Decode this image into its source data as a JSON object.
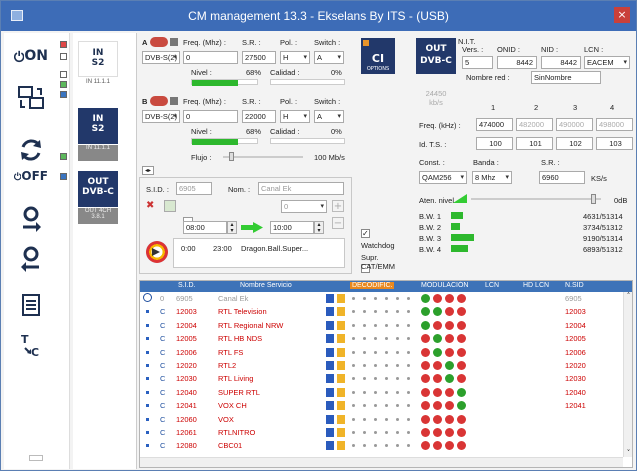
{
  "window": {
    "title": "CM management 13.3 - Ekselans By ITS - (USB)"
  },
  "colors": {
    "titlebar": "#3d6cb7",
    "accent": "#2a4f8f",
    "signal": "#2db82d",
    "crypt_red": "#cc2222"
  },
  "sidebar": {
    "on_label": "ON",
    "off_label": "OFF"
  },
  "tuners": [
    {
      "line1": "IN",
      "line2": "S2",
      "sub": "IN 11.1.1"
    },
    {
      "line1": "IN",
      "line2": "S2",
      "sub": "IN 11.1.1"
    },
    {
      "line1": "OUT",
      "line2": "DVB-C",
      "sub": "OUT 4CH 3.8.1"
    }
  ],
  "tuner_a": {
    "name": "A",
    "freq_label": "Freq. (Mhz) :",
    "sr_label": "S.R. :",
    "pol_label": "Pol. :",
    "switch_label": "Switch :",
    "mode": "DVB-S(2)",
    "freq": "0",
    "sr": "27500",
    "pol": "H",
    "switch": "A",
    "nivel_label": "Nivel :",
    "nivel": "68%",
    "calidad_label": "Calidad :",
    "calidad": "0%",
    "nivel_fraction": 0.68
  },
  "tuner_b": {
    "name": "B",
    "freq_label": "Freq. (Mhz) :",
    "sr_label": "S.R. :",
    "pol_label": "Pol. :",
    "switch_label": "Switch :",
    "mode": "DVB-S(2)",
    "freq": "0",
    "sr": "22000",
    "pol": "H",
    "switch": "A",
    "nivel_label": "Nivel :",
    "nivel": "68%",
    "calidad_label": "Calidad :",
    "calidad": "0%",
    "nivel_fraction": 0.68
  },
  "flujo": {
    "label": "Flujo :",
    "value": "100 Mb/s"
  },
  "service": {
    "sid_label": "S.I.D. :",
    "sid": "6905",
    "nom_label": "Nom. :",
    "nom": "Canal Ek",
    "channel": "0",
    "start": "08:00",
    "end": "10:00",
    "epg_start": "0:00",
    "epg_end": "23:00",
    "epg_title": "Dragon.Ball.Super..."
  },
  "checks": {
    "watchdog": "Watchdog",
    "supr": "Supr. CAT/EMM"
  },
  "ci": {
    "label": "CI",
    "sub": "OPTIONS"
  },
  "output": {
    "badge_line1": "OUT",
    "badge_line2": "DVB-C",
    "nit_label": "N.I.T.",
    "vers_label": "Vers. :",
    "onid_label": "ONID :",
    "nid_label": "NID :",
    "lcn_label": "LCN :",
    "vers": "5",
    "onid": "8442",
    "nid": "8442",
    "lcn": "EACEM",
    "nombre_red_label": "Nombre red :",
    "nombre_red": "SinNombre",
    "kbs": "24450 kb/s",
    "channels": [
      "1",
      "2",
      "3",
      "4"
    ],
    "freq_label": "Freq. (kHz) :",
    "freqs": [
      "474000",
      "482000",
      "490000",
      "498000"
    ],
    "ts_label": "Id. T.S. :",
    "ts": [
      "100",
      "101",
      "102",
      "103"
    ],
    "const_label": "Const. :",
    "banda_label": "Banda :",
    "sr_label": "S.R. :",
    "const": "QAM256",
    "banda": "8 Mhz",
    "sr": "6960",
    "sr_unit": "KS/s",
    "aten_label": "Aten. nivel",
    "aten_value": "0dB",
    "bw": [
      {
        "label": "B.W. 1",
        "value": "4631/51314",
        "fraction": 0.09
      },
      {
        "label": "B.W. 2",
        "value": "3734/51312",
        "fraction": 0.07
      },
      {
        "label": "B.W. 3",
        "value": "9190/51314",
        "fraction": 0.18
      },
      {
        "label": "B.W. 4",
        "value": "6893/51312",
        "fraction": 0.13
      }
    ]
  },
  "table": {
    "headers": {
      "sid": "S.I.D.",
      "name": "Nombre Servicio",
      "decod": "DECODIFIC.",
      "mod": "MODULACIÓN",
      "lcn": "LCN",
      "hdlcn": "HD LCN",
      "nsid": "N.SID"
    },
    "rows": [
      {
        "c": "0",
        "sid": "6905",
        "name": "Canal Ek",
        "nsid": "6905",
        "dim": true,
        "mods": [
          "g",
          "r",
          "r",
          "r"
        ]
      },
      {
        "c": "C",
        "sid": "12003",
        "name": "RTL Television",
        "nsid": "12003",
        "dim": false,
        "mods": [
          "g",
          "g",
          "r",
          "r"
        ]
      },
      {
        "c": "C",
        "sid": "12004",
        "name": "RTL Regional NRW",
        "nsid": "12004",
        "dim": false,
        "mods": [
          "g",
          "r",
          "r",
          "r"
        ]
      },
      {
        "c": "C",
        "sid": "12005",
        "name": "RTL HB NDS",
        "nsid": "12005",
        "dim": false,
        "mods": [
          "r",
          "g",
          "r",
          "r"
        ]
      },
      {
        "c": "C",
        "sid": "12006",
        "name": "RTL FS",
        "nsid": "12006",
        "dim": false,
        "mods": [
          "r",
          "g",
          "r",
          "r"
        ]
      },
      {
        "c": "C",
        "sid": "12020",
        "name": "RTL2",
        "nsid": "12020",
        "dim": false,
        "mods": [
          "r",
          "r",
          "g",
          "r"
        ]
      },
      {
        "c": "C",
        "sid": "12030",
        "name": "RTL Living",
        "nsid": "12030",
        "dim": false,
        "mods": [
          "r",
          "r",
          "g",
          "r"
        ]
      },
      {
        "c": "C",
        "sid": "12040",
        "name": "SUPER RTL",
        "nsid": "12040",
        "dim": false,
        "mods": [
          "r",
          "r",
          "r",
          "g"
        ]
      },
      {
        "c": "C",
        "sid": "12041",
        "name": "VOX CH",
        "nsid": "12041",
        "dim": false,
        "mods": [
          "r",
          "r",
          "r",
          "g"
        ]
      },
      {
        "c": "C",
        "sid": "12060",
        "name": "VOX",
        "nsid": "",
        "dim": false,
        "mods": [
          "r",
          "r",
          "r",
          "r"
        ]
      },
      {
        "c": "C",
        "sid": "12061",
        "name": "RTLNITRO",
        "nsid": "",
        "dim": false,
        "mods": [
          "r",
          "r",
          "r",
          "r"
        ]
      },
      {
        "c": "C",
        "sid": "12080",
        "name": "CBC01",
        "nsid": "",
        "dim": false,
        "mods": [
          "r",
          "r",
          "r",
          "r"
        ]
      }
    ]
  }
}
